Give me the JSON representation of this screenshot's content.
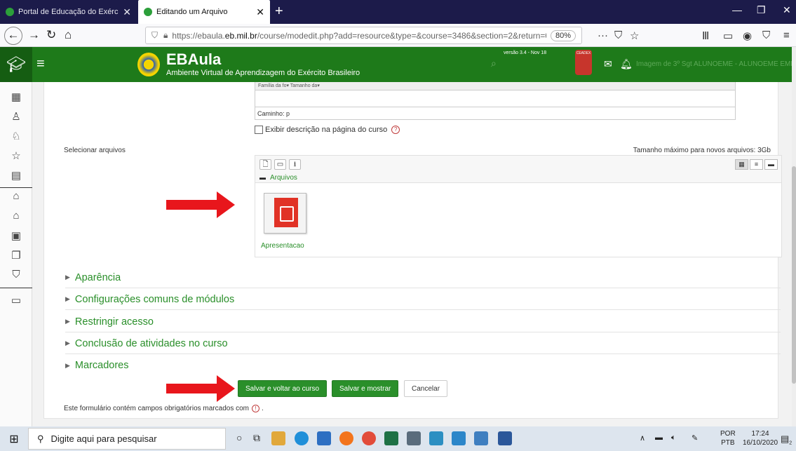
{
  "browser": {
    "tabs": [
      {
        "title": "Portal de Educação do Exército",
        "active": false
      },
      {
        "title": "Editando um Arquivo",
        "active": true
      }
    ],
    "url_prefix": "https://ebaula.",
    "url_host": "eb.mil.br",
    "url_rest": "/course/modedit.php?add=resource&type=&course=3486&section=2&return=0&",
    "zoom": "80%"
  },
  "header": {
    "brand": "EBAula",
    "subtitle": "Ambiente Virtual de Aprendizagem do Exército Brasileiro",
    "version": "versão 3.4 - Nov 18",
    "badge": "CEADEX",
    "user": "Imagem de 3º Sgt ALUNOEME - ALUNOEME EME"
  },
  "editor": {
    "toolbar_text": "Família da fo▾   Tamanho da▾",
    "path": "Caminho: p"
  },
  "form": {
    "show_description_label": "Exibir descrição na página do curso",
    "select_files_label": "Selecionar arquivos",
    "max_size_label": "Tamanho máximo para novos arquivos: 3Gb",
    "folder_path": "Arquivos",
    "file_name": "Apresentacao"
  },
  "sections": [
    {
      "label": "Aparência"
    },
    {
      "label": "Configurações comuns de módulos"
    },
    {
      "label": "Restringir acesso"
    },
    {
      "label": "Conclusão de atividades no curso"
    },
    {
      "label": "Marcadores"
    }
  ],
  "buttons": {
    "save_return": "Salvar e voltar ao curso",
    "save_show": "Salvar e mostrar",
    "cancel": "Cancelar"
  },
  "required_note": "Este formulário contém campos obrigatórios marcados com",
  "taskbar": {
    "search_placeholder": "Digite aqui para pesquisar",
    "lang_1": "POR",
    "lang_2": "PTB",
    "time": "17:24",
    "date": "16/10/2020",
    "notif_count": "2"
  },
  "colors": {
    "brand_green": "#1e7a1a",
    "link_green": "#2a8f2a",
    "annotation_red": "#e8161c"
  }
}
